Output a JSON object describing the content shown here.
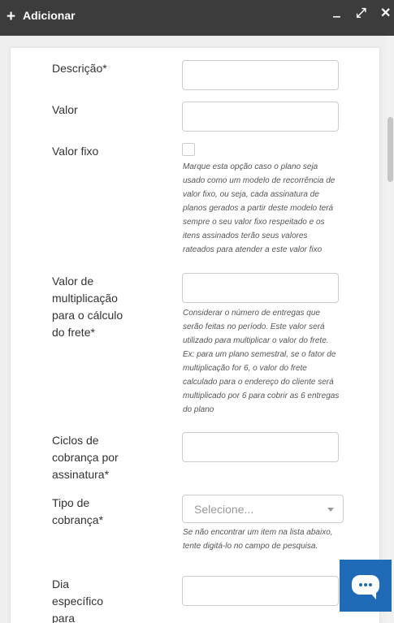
{
  "header": {
    "title": "Adicionar",
    "plus": "+",
    "min": "‒",
    "max": "⤢",
    "close": "✕"
  },
  "form": {
    "descricao_label": "Descrição*",
    "valor_label": "Valor",
    "valor_fixo_label": "Valor fixo",
    "valor_fixo_help": "Marque esta opção caso o plano seja usado como um modelo de recorrência de valor fixo, ou seja, cada assinatura de planos gerados a partir deste modelo terá sempre o seu valor fixo respeitado e os itens assinados terão seus valores rateados para atender a este valor fixo",
    "multiplicacao_label": "Valor de multiplicação para o cálculo do frete*",
    "multiplicacao_help": "Considerar o número de entregas que serão feitas no período. Este valor será utilizado para multiplicar o valor do frete. Ex: para um plano semestral, se o fator de multiplicação for 6, o valor do frete calculado para o endereço do cliente será multiplicado por 6 para cobrir as 6 entregas do plano",
    "ciclos_label": "Ciclos de cobrança por assinatura*",
    "tipo_label": "Tipo de cobrança*",
    "tipo_placeholder": "Selecione...",
    "tipo_help": "Se não encontrar um item na lista abaixo, tente digitá-lo no campo de pesquisa.",
    "dia_label": "Dia específico para"
  }
}
